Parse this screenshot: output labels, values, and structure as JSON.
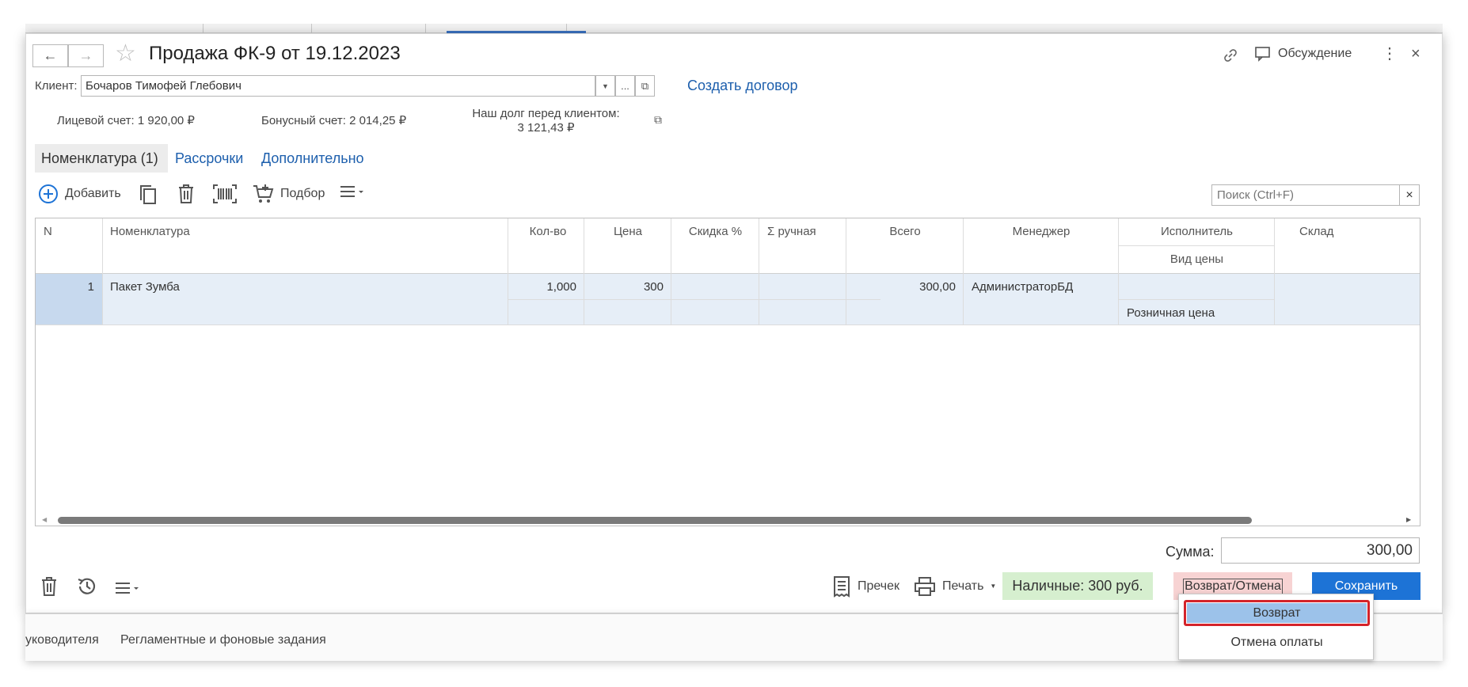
{
  "document": {
    "title": "Продажа ФК-9 от 19.12.2023",
    "discussion_label": "Обсуждение"
  },
  "client": {
    "label": "Клиент:",
    "value": "Бочаров Тимофей Глебович",
    "more_label": "...",
    "create_contract": "Создать договор"
  },
  "accounts": {
    "personal": "Лицевой счет: 1 920,00 ₽",
    "bonus": "Бонусный счет: 2 014,25 ₽",
    "debt_label": "Наш долг перед клиентом:",
    "debt_value": "3 121,43 ₽"
  },
  "tabs": [
    {
      "label": "Номенклатура (1)",
      "active": true
    },
    {
      "label": "Рассрочки",
      "active": false
    },
    {
      "label": "Дополнительно",
      "active": false
    }
  ],
  "toolbar": {
    "add_label": "Добавить",
    "selection_label": "Подбор",
    "search_placeholder": "Поиск (Ctrl+F)",
    "search_clear": "×"
  },
  "table": {
    "headers": {
      "n": "N",
      "item": "Номенклатура",
      "qty": "Кол-во",
      "price": "Цена",
      "discount": "Скидка %",
      "manual_sum": "Σ ручная",
      "total": "Всего",
      "manager": "Менеджер",
      "executor": "Исполнитель",
      "price_type": "Вид цены",
      "warehouse": "Склад"
    },
    "rows": [
      {
        "n": "1",
        "item": "Пакет Зумба",
        "qty": "1,000",
        "price": "300",
        "discount": "",
        "manual_sum": "",
        "total": "300,00",
        "manager": "АдминистраторБД",
        "executor": "",
        "price_type": "Розничная цена",
        "warehouse": ""
      }
    ]
  },
  "summary": {
    "label": "Сумма:",
    "value": "300,00"
  },
  "actions": {
    "precheck": "Пречек",
    "print": "Печать",
    "cash": "Наличные: 300 руб.",
    "return_cancel": "Возврат/Отмена",
    "save": "Сохранить"
  },
  "dropdown": {
    "items": [
      "Возврат",
      "Отмена оплаты"
    ]
  },
  "footer": {
    "items": [
      "уководителя",
      "Регламентные и фоновые задания"
    ]
  },
  "colors": {
    "accent": "#1d73d6",
    "link": "#1d5fad",
    "cash_bg": "#d6efcf",
    "return_bg": "#f7d3d3",
    "selected_row": "#e6eef7",
    "highlight_border": "#d4242b"
  }
}
